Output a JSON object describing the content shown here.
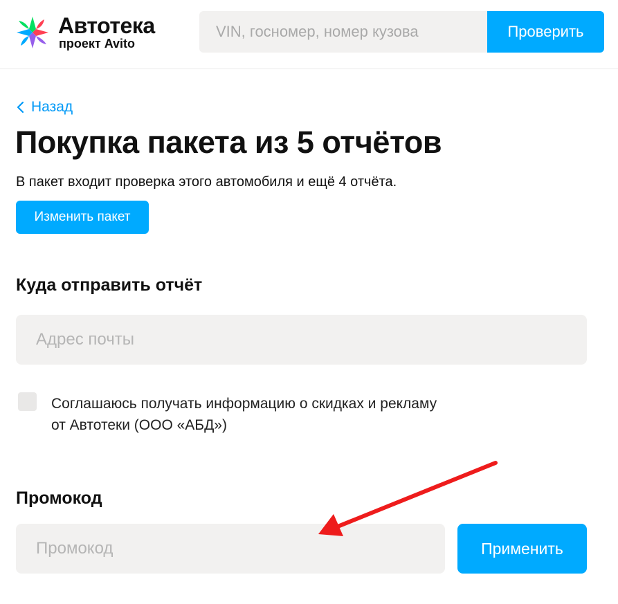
{
  "header": {
    "logo_title": "Автотека",
    "logo_subtitle": "проект Avito",
    "search_placeholder": "VIN, госномер, номер кузова",
    "check_label": "Проверить"
  },
  "main": {
    "back_label": "Назад",
    "title": "Покупка пакета из 5 отчётов",
    "subtitle": "В пакет входит проверка этого автомобиля и ещё 4 отчёта.",
    "change_package_label": "Изменить пакет",
    "send_section_title": "Куда отправить отчёт",
    "email_placeholder": "Адрес почты",
    "consent_line1": "Соглашаюсь получать информацию о скидках и рекламу",
    "consent_line2": "от Автотеки (ООО «АБД»)",
    "promo_section_title": "Промокод",
    "promo_placeholder": "Промокод",
    "apply_label": "Применить"
  },
  "colors": {
    "accent": "#00aaff",
    "link": "#0099f7",
    "field_bg": "#f2f1f0",
    "annotation_arrow": "#ee1c1c"
  },
  "icons": {
    "logo": "autoteka-logo-icon",
    "back": "chevron-left-icon",
    "annotation": "red-arrow-icon"
  }
}
